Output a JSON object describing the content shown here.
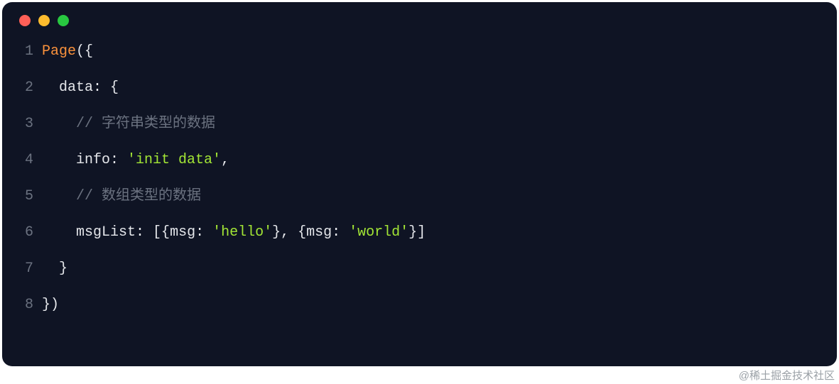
{
  "theme": {
    "background": "#0f1424",
    "keyword": "#fb923c",
    "default": "#e5e7eb",
    "comment": "#6b7280",
    "string": "#a3e635"
  },
  "traffic_lights": {
    "close_color": "#ff5f57",
    "minimize_color": "#febc2e",
    "zoom_color": "#28c840"
  },
  "code": {
    "lines": [
      {
        "n": "1",
        "indent": "",
        "segments": [
          {
            "t": "Page",
            "c": "kw"
          },
          {
            "t": "({",
            "c": "punct"
          }
        ]
      },
      {
        "n": "2",
        "indent": "  ",
        "segments": [
          {
            "t": "data: ",
            "c": "key"
          },
          {
            "t": "{",
            "c": "punct"
          }
        ]
      },
      {
        "n": "3",
        "indent": "    ",
        "segments": [
          {
            "t": "// 字符串类型的数据",
            "c": "comment"
          }
        ]
      },
      {
        "n": "4",
        "indent": "    ",
        "segments": [
          {
            "t": "info: ",
            "c": "key"
          },
          {
            "t": "'init data'",
            "c": "string"
          },
          {
            "t": ",",
            "c": "punct"
          }
        ]
      },
      {
        "n": "5",
        "indent": "    ",
        "segments": [
          {
            "t": "// 数组类型的数据",
            "c": "comment"
          }
        ]
      },
      {
        "n": "6",
        "indent": "    ",
        "segments": [
          {
            "t": "msgList: ",
            "c": "key"
          },
          {
            "t": "[{",
            "c": "punct"
          },
          {
            "t": "msg: ",
            "c": "key"
          },
          {
            "t": "'hello'",
            "c": "string"
          },
          {
            "t": "}, {",
            "c": "punct"
          },
          {
            "t": "msg: ",
            "c": "key"
          },
          {
            "t": "'world'",
            "c": "string"
          },
          {
            "t": "}]",
            "c": "punct"
          }
        ]
      },
      {
        "n": "7",
        "indent": "  ",
        "segments": [
          {
            "t": "}",
            "c": "punct"
          }
        ]
      },
      {
        "n": "8",
        "indent": "",
        "segments": [
          {
            "t": "})",
            "c": "punct"
          }
        ]
      }
    ]
  },
  "watermark": "@稀土掘金技术社区"
}
